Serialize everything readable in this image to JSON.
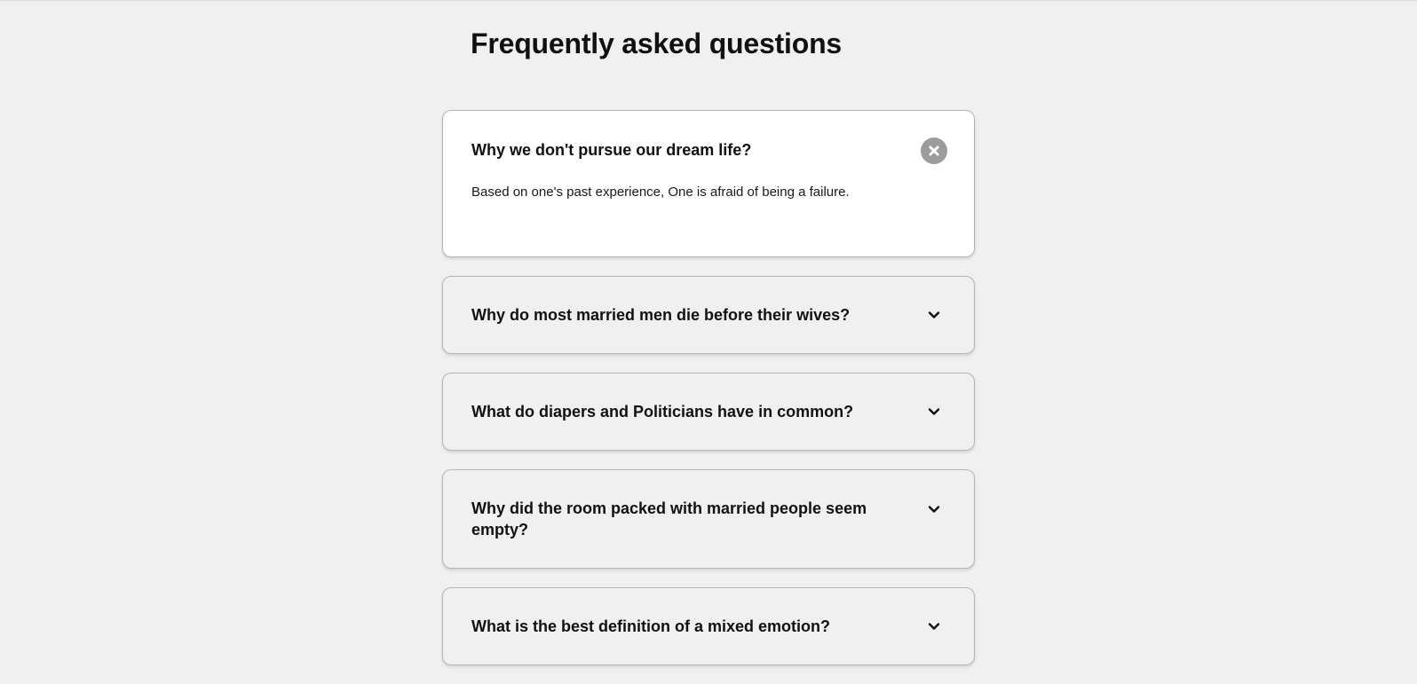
{
  "page": {
    "title": "Frequently asked questions"
  },
  "faq": {
    "items": [
      {
        "question": "Why we don't pursue our dream life?",
        "answer": "Based on one's past experience, One is afraid of being a failure.",
        "state": "expanded",
        "icon": "close-icon"
      },
      {
        "question": "Why do most married men die before their wives?",
        "state": "collapsed",
        "icon": "chevron-down-icon"
      },
      {
        "question": "What do diapers and Politicians have in common?",
        "state": "collapsed",
        "icon": "chevron-down-icon"
      },
      {
        "question": "Why did the room packed with married people seem empty?",
        "state": "collapsed",
        "icon": "chevron-down-icon"
      },
      {
        "question": "What is the best definition of a mixed emotion?",
        "state": "collapsed",
        "icon": "chevron-down-icon"
      }
    ]
  },
  "colors": {
    "background": "#f0f0f0",
    "card_open": "#ffffff",
    "card_border": "#b5b5b5",
    "close_button": "#9c9c9c",
    "text": "#111111"
  }
}
